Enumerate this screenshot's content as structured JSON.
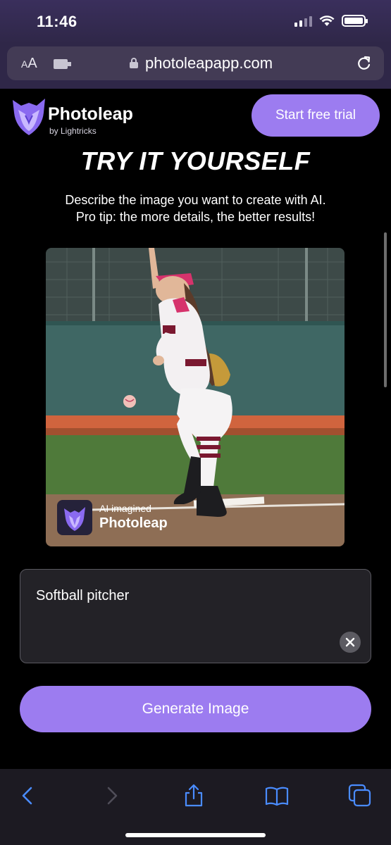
{
  "status_bar": {
    "time": "11:46"
  },
  "browser": {
    "text_size_label_big": "A",
    "text_size_label_small": "A",
    "url": "photoleapapp.com"
  },
  "site": {
    "brand_name": "Photoleap",
    "brand_sub": "by Lightricks",
    "trial_button": "Start free trial",
    "hero_title": "TRY IT YOURSELF",
    "hero_desc_line1": "Describe the image you want to create with AI.",
    "hero_desc_line2": "Pro tip: the more details, the better results!",
    "watermark_line1": "AI imagined",
    "watermark_line2": "Photoleap",
    "prompt_value": "Softball pitcher",
    "generate_button": "Generate Image"
  },
  "colors": {
    "accent": "#9c7cf0",
    "background": "#000000",
    "status_bar": "#3a2f5c"
  },
  "icons": {
    "browser_extension": "puzzle-icon",
    "lock": "lock-icon",
    "reload": "reload-icon",
    "back": "chevron-left-icon",
    "forward": "chevron-right-icon",
    "share": "share-icon",
    "bookmarks": "book-icon",
    "tabs": "tabs-icon",
    "clear": "close-icon"
  }
}
